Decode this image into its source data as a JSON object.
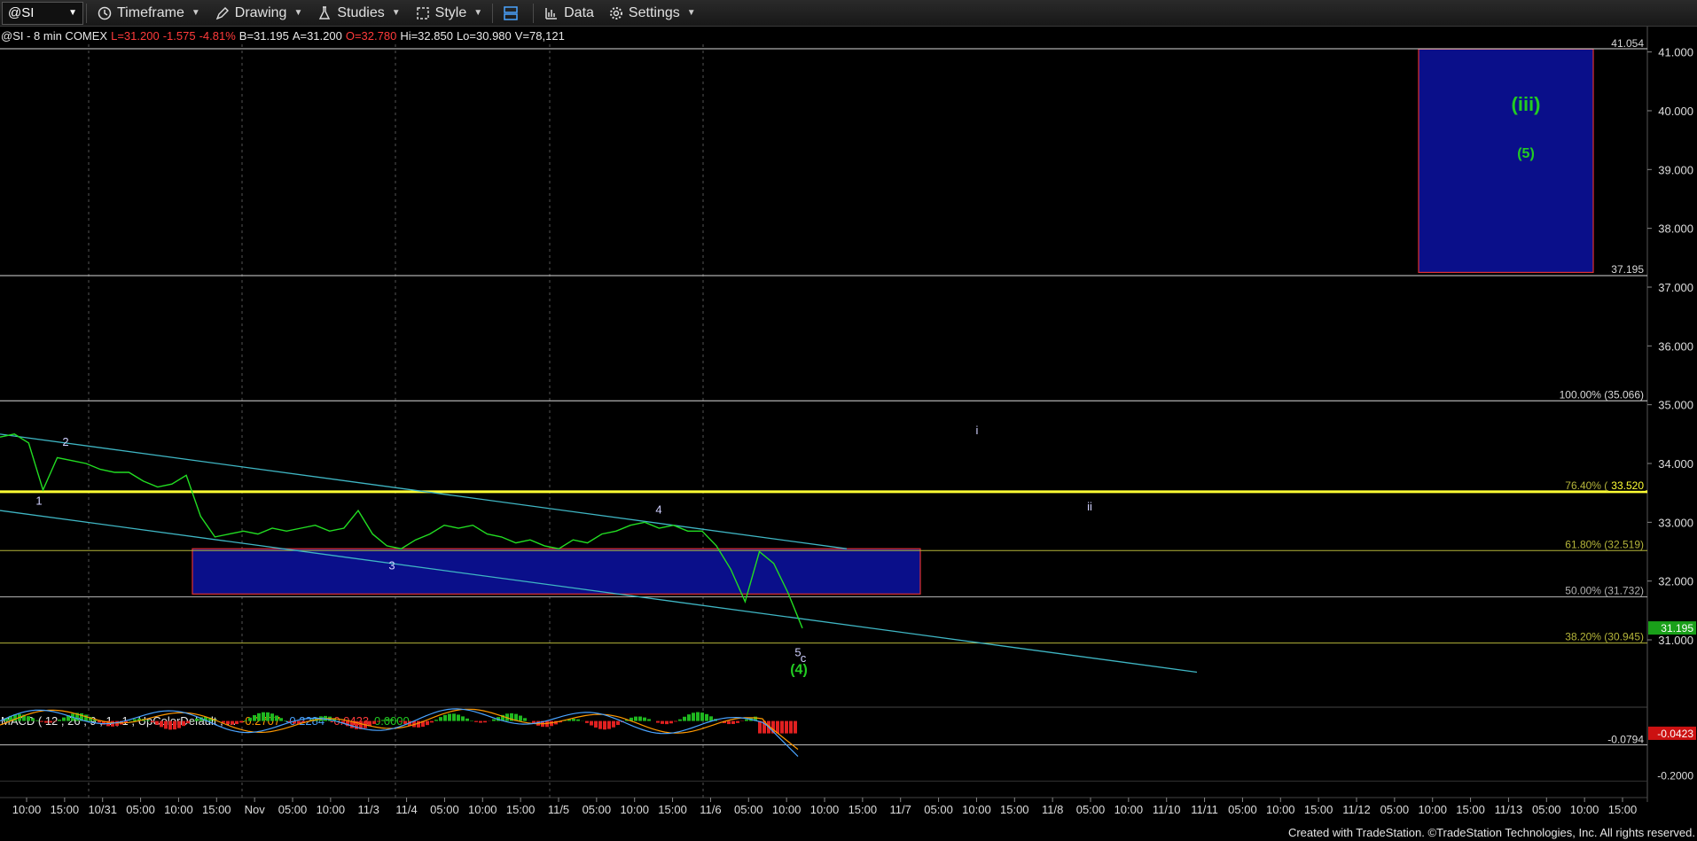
{
  "toolbar": {
    "symbol": "@SI",
    "items": [
      {
        "label": "Timeframe",
        "icon": "clock-icon"
      },
      {
        "label": "Drawing",
        "icon": "pencil-icon"
      },
      {
        "label": "Studies",
        "icon": "flask-icon"
      },
      {
        "label": "Style",
        "icon": "style-icon"
      },
      {
        "label": "",
        "icon": "layout-icon"
      },
      {
        "label": "Data",
        "icon": "bar-chart-icon"
      },
      {
        "label": "Settings",
        "icon": "gear-icon"
      }
    ]
  },
  "infobar": {
    "symbol": "@SI - 8 min  COMEX",
    "last": "L=31.200",
    "change": "-1.575",
    "pct": "-4.81%",
    "bid": "B=31.195",
    "ask": "A=31.200",
    "open": "O=32.780",
    "high": "Hi=32.850",
    "low": "Lo=30.980",
    "volume": "V=78,121"
  },
  "chart_data": {
    "type": "line",
    "ylim": [
      29.9,
      41.1
    ],
    "yticks": [
      "41.000",
      "40.000",
      "39.000",
      "38.000",
      "37.000",
      "36.000",
      "35.000",
      "34.000",
      "33.000",
      "32.000",
      "31.000"
    ],
    "ytick_values": [
      41,
      40,
      39,
      38,
      37,
      36,
      35,
      34,
      33,
      32,
      31
    ],
    "xticks": [
      "10:00",
      "15:00",
      "10/31",
      "05:00",
      "10:00",
      "15:00",
      "Nov",
      "05:00",
      "10:00",
      "11/3",
      "11/4",
      "05:00",
      "10:00",
      "15:00",
      "11/5",
      "05:00",
      "10:00",
      "15:00",
      "11/6",
      "05:00",
      "10:00",
      "10:00",
      "15:00",
      "11/7",
      "05:00",
      "10:00",
      "15:00",
      "11/8",
      "05:00",
      "10:00",
      "11/10",
      "11/11",
      "05:00",
      "10:00",
      "15:00",
      "11/12",
      "05:00",
      "10:00",
      "15:00",
      "11/13",
      "05:00",
      "10:00",
      "15:00"
    ],
    "current_price": "31.195",
    "levels": [
      {
        "value": 41.054,
        "label": "41.054",
        "color": "#d9d9d9"
      },
      {
        "value": 37.195,
        "label": "37.195",
        "color": "#d9d9d9"
      },
      {
        "value": 35.066,
        "label": "100.00% (35.066)",
        "color": "#d9d9d9"
      },
      {
        "value": 33.52,
        "label": "76.40% (33.520)",
        "color": "#ffff33",
        "tag": "33.520"
      },
      {
        "value": 32.519,
        "label": "61.80% (32.519)",
        "color": "#b5b53a"
      },
      {
        "value": 31.732,
        "label": "50.00% (31.732)",
        "color": "#b0b0b0"
      },
      {
        "value": 30.945,
        "label": "38.20% (30.945)",
        "color": "#b5b53a"
      }
    ],
    "boxes": [
      {
        "name": "target-box-iii",
        "y_top": 41.05,
        "y_bottom": 37.25,
        "fill": "#0a0f8a",
        "border": "#e03030"
      },
      {
        "name": "support-box",
        "y_top": 32.55,
        "y_bottom": 31.78,
        "fill": "#0a0f8a",
        "border": "#e03030"
      }
    ],
    "wave_labels": [
      {
        "text": "1",
        "y": 33.3,
        "color": "#d0d0ff"
      },
      {
        "text": "2",
        "y": 34.3,
        "color": "#d0d0ff"
      },
      {
        "text": "3",
        "y": 32.2,
        "color": "#d0d0ff"
      },
      {
        "text": "4",
        "y": 33.15,
        "color": "#d0d0ff"
      },
      {
        "text": "5",
        "y": 30.72,
        "color": "#d0d0ff"
      },
      {
        "text": "c",
        "y": 30.62,
        "color": "#d0d0ff"
      },
      {
        "text": "(4)",
        "y": 30.42,
        "color": "#22cc22"
      },
      {
        "text": "i",
        "y": 34.5,
        "color": "#d0d0ff"
      },
      {
        "text": "ii",
        "y": 33.2,
        "color": "#d0d0ff"
      },
      {
        "text": "(iii)",
        "y": 40.0,
        "color": "#22cc22"
      },
      {
        "text": "(5)",
        "y": 39.2,
        "color": "#22cc22"
      }
    ],
    "price_series": [
      34.45,
      34.5,
      34.35,
      33.55,
      34.1,
      34.05,
      34.0,
      33.9,
      33.85,
      33.85,
      33.7,
      33.6,
      33.65,
      33.8,
      33.1,
      32.75,
      32.8,
      32.85,
      32.8,
      32.9,
      32.85,
      32.9,
      32.95,
      32.85,
      32.9,
      33.2,
      32.8,
      32.6,
      32.55,
      32.7,
      32.8,
      32.95,
      32.9,
      32.95,
      32.8,
      32.75,
      32.65,
      32.7,
      32.6,
      32.55,
      32.7,
      32.65,
      32.8,
      32.85,
      32.95,
      33.0,
      32.9,
      32.95,
      32.85,
      32.85,
      32.6,
      32.2,
      31.65,
      32.5,
      32.3,
      31.8,
      31.2
    ],
    "trendlines": [
      {
        "name": "upper-channel",
        "color": "#3fb6c4"
      },
      {
        "name": "lower-channel",
        "color": "#3fb6c4"
      }
    ],
    "macd": {
      "label": "MACD ( 12 , 26 , 9 , 1 , 1 , UpColorDefault , ...",
      "values": [
        "-0.2707",
        "-0.2284",
        "-0.0423",
        "0.0000"
      ],
      "value_colors": [
        "#ff9900",
        "#4aa3ff",
        "#ff3b3b",
        "#22cc22"
      ],
      "ylim": [
        -0.24,
        0.04
      ],
      "yticks": [
        "-0.0794",
        "-0.2000"
      ],
      "ytick_values": [
        -0.0794,
        -0.2
      ],
      "current": "-0.0423"
    }
  },
  "footer": {
    "credit": "Created with TradeStation. ©TradeStation Technologies, Inc. All rights reserved."
  }
}
